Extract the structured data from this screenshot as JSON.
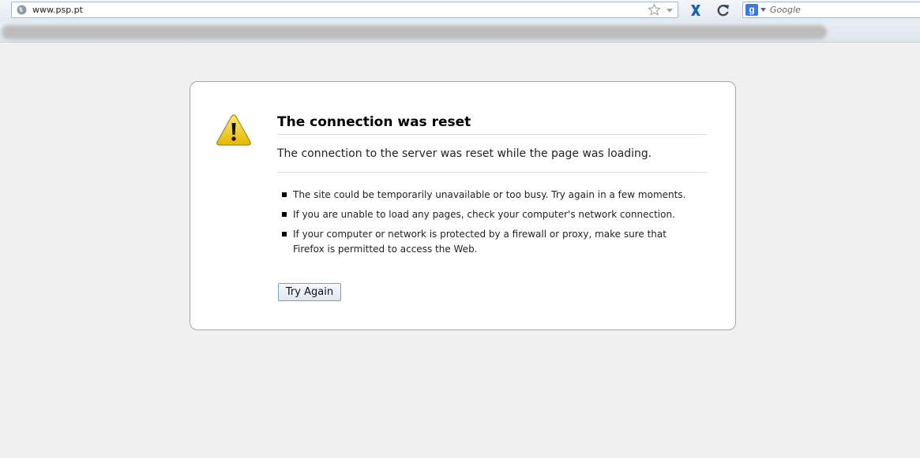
{
  "browser": {
    "url": "www.psp.pt",
    "search_placeholder": "Google",
    "search_engine_letter": "g",
    "icons": {
      "site": "globe-icon",
      "bookmark": "star-icon",
      "dropdown": "chevron-down-icon",
      "stop": "stop-icon",
      "reload": "reload-icon",
      "engine": "google-icon"
    }
  },
  "error": {
    "title": "The connection was reset",
    "description": "The connection to the server was reset while the page was loading.",
    "suggestions": [
      "The site could be temporarily unavailable or too busy. Try again in a few moments.",
      "If you are unable to load any pages, check your computer's network connection.",
      "If your computer or network is protected by a firewall or proxy, make sure that Firefox is permitted to access the Web."
    ],
    "button_label": "Try Again",
    "icon": "warning-icon"
  },
  "colors": {
    "page_background": "#f0f0f0",
    "accent_stop": "#1b62b5",
    "warning_yellow": "#f2d01a"
  }
}
